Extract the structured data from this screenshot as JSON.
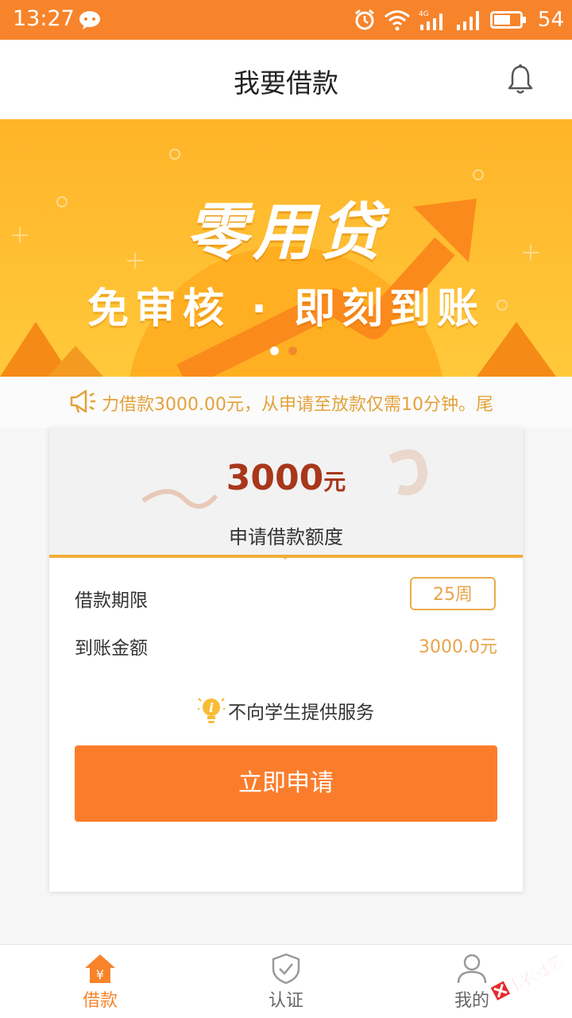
{
  "status_bar": {
    "time": "13:27",
    "network": "4G",
    "battery": "54"
  },
  "header": {
    "title": "我要借款"
  },
  "banner": {
    "headline": "零用贷",
    "subline": "免审核 · 即刻到账",
    "page_count": 2,
    "active_page": 1
  },
  "notice": {
    "text": "力借款3000.00元，从申请至放款仅需10分钟。尾"
  },
  "loan_card": {
    "amount": "3000",
    "amount_unit": "元",
    "amount_label": "申请借款额度",
    "term_label": "借款期限",
    "term_value": "25周",
    "arrive_label": "到账金额",
    "arrive_value": "3000.0元",
    "tip": "不向学生提供服务",
    "apply_button": "立即申请"
  },
  "tabbar": {
    "items": [
      {
        "label": "借款",
        "icon": "home-yen-icon",
        "active": true
      },
      {
        "label": "认证",
        "icon": "shield-check-icon",
        "active": false
      },
      {
        "label": "我的",
        "icon": "user-icon",
        "active": false
      }
    ]
  },
  "watermark": {
    "text": "卡农社区"
  },
  "colors": {
    "accent": "#f7842b",
    "button": "#fb7d2c",
    "gold": "#e9a34a",
    "amount": "#a8371b",
    "tab_inactive": "#999999"
  }
}
